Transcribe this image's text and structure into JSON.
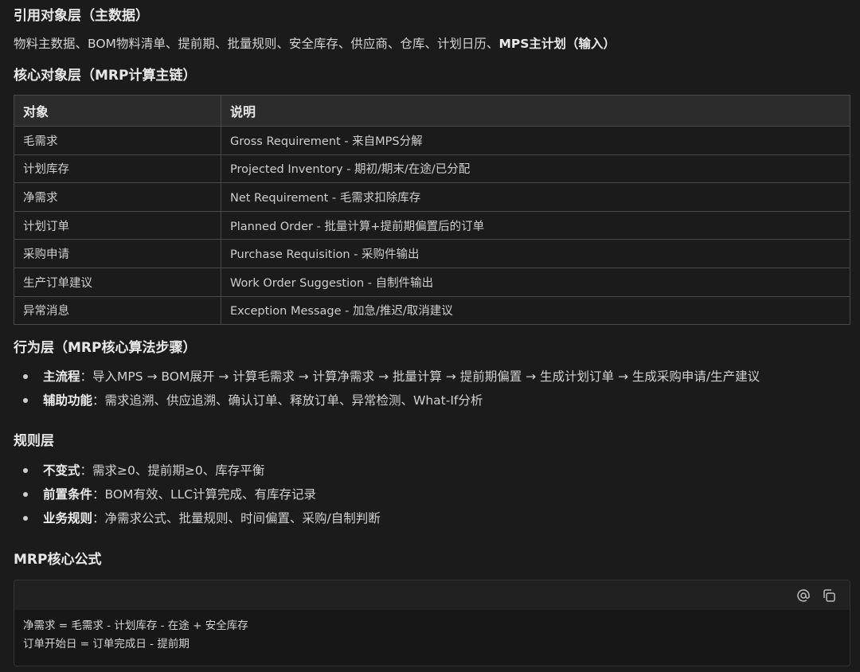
{
  "sections": {
    "ref_title": "引用对象层（主数据）",
    "ref_items": "物料主数据、BOM物料清单、提前期、批量规则、安全库存、供应商、仓库、计划日历、",
    "ref_items_bold": "MPS主计划（输入）",
    "core_title": "核心对象层（MRP计算主链）",
    "behavior_title": "行为层（MRP核心算法步骤）",
    "rules_title": "规则层",
    "formula_title": "MRP核心公式"
  },
  "table": {
    "headers": [
      "对象",
      "说明"
    ],
    "rows": [
      [
        "毛需求",
        "Gross Requirement - 来自MPS分解"
      ],
      [
        "计划库存",
        "Projected Inventory - 期初/期末/在途/已分配"
      ],
      [
        "净需求",
        "Net Requirement - 毛需求扣除库存"
      ],
      [
        "计划订单",
        "Planned Order - 批量计算+提前期偏置后的订单"
      ],
      [
        "采购申请",
        "Purchase Requisition - 采购件输出"
      ],
      [
        "生产订单建议",
        "Work Order Suggestion - 自制件输出"
      ],
      [
        "异常消息",
        "Exception Message - 加急/推迟/取消建议"
      ]
    ]
  },
  "behavior": [
    {
      "label": "主流程",
      "text": "：导入MPS → BOM展开 → 计算毛需求 → 计算净需求 → 批量计算 → 提前期偏置 → 生成计划订单 → 生成采购申请/生产建议"
    },
    {
      "label": "辅助功能",
      "text": "：需求追溯、供应追溯、确认订单、释放订单、异常检测、What-If分析"
    }
  ],
  "rules": [
    {
      "label": "不变式",
      "text": "：需求≥0、提前期≥0、库存平衡"
    },
    {
      "label": "前置条件",
      "text": "：BOM有效、LLC计算完成、有库存记录"
    },
    {
      "label": "业务规则",
      "text": "：净需求公式、批量规则、时间偏置、采购/自制判断"
    }
  ],
  "code": {
    "line1": "净需求 = 毛需求 - 计划库存 - 在途 + 安全库存",
    "line2": "订单开始日 = 订单完成日 - 提前期"
  },
  "icons": {
    "mention": "at-icon",
    "copy": "copy-icon"
  }
}
